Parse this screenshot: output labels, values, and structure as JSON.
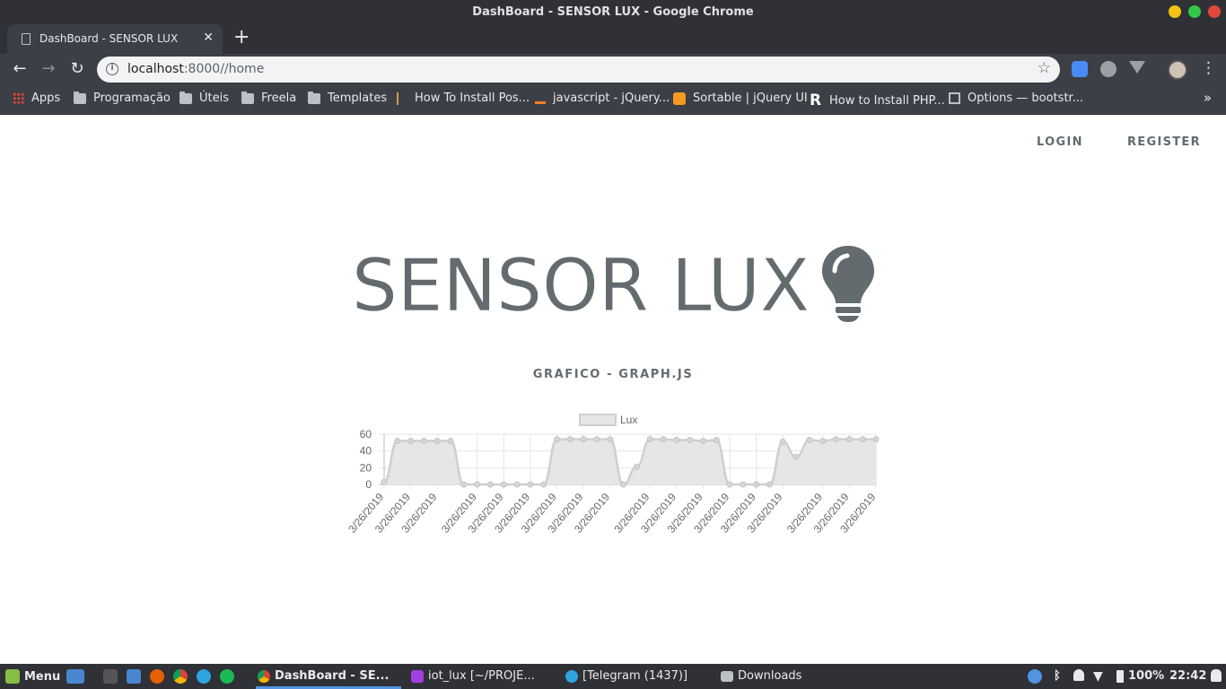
{
  "window": {
    "title": "DashBoard - SENSOR LUX - Google Chrome"
  },
  "tab": {
    "title": "DashBoard - SENSOR LUX",
    "close": "✕",
    "new_tab": "+"
  },
  "toolbar": {
    "back": "←",
    "forward": "→",
    "reload": "↻",
    "url_host": "localhost",
    "url_rest": ":8000//home",
    "info": "i",
    "star": "☆",
    "menu": "⋮"
  },
  "bookmarks": {
    "items": [
      {
        "label": "Apps",
        "icon": "apps-grid-icon"
      },
      {
        "label": "Programação",
        "icon": "folder-icon"
      },
      {
        "label": "Úteis",
        "icon": "folder-icon"
      },
      {
        "label": "Freela",
        "icon": "folder-icon"
      },
      {
        "label": "Templates",
        "icon": "folder-icon"
      },
      {
        "label": "How To Install Pos...",
        "icon": "favicon-icon"
      },
      {
        "label": "javascript - jQuery...",
        "icon": "stackoverflow-icon"
      },
      {
        "label": "Sortable | jQuery UI",
        "icon": "jquery-icon"
      },
      {
        "label": "How to Install PHP...",
        "icon": "r-icon"
      },
      {
        "label": "Options — bootstr...",
        "icon": "bootstrap-icon"
      }
    ],
    "more": "»"
  },
  "page": {
    "nav": {
      "login": "LOGIN",
      "register": "REGISTER"
    },
    "hero_title": "SENSOR LUX",
    "hero_icon": "lightbulb-icon",
    "subtitle": "GRAFICO - GRAPH.JS"
  },
  "chart_data": {
    "type": "line",
    "legend": [
      "Lux"
    ],
    "legend_position": "top",
    "grid": true,
    "fill": true,
    "ylim": [
      0,
      60
    ],
    "yticks": [
      0,
      20,
      40,
      60
    ],
    "x": [
      "3/26/2019",
      "3/26/2019",
      "3/26/2019",
      "3/26/2019",
      "3/26/2019",
      "3/26/2019",
      "3/26/2019",
      "3/26/2019",
      "3/26/2019",
      "3/26/2019",
      "3/26/2019",
      "3/26/2019",
      "3/26/2019",
      "3/26/2019",
      "3/26/2019",
      "3/26/2019",
      "3/26/2019",
      "3/26/2019",
      "3/26/2019",
      "3/26/2019",
      "3/26/2019",
      "3/26/2019",
      "3/26/2019",
      "3/26/2019",
      "3/26/2019",
      "3/26/2019",
      "3/26/2019",
      "3/26/2019",
      "3/26/2019",
      "3/26/2019",
      "3/26/2019",
      "3/26/2019",
      "3/26/2019",
      "3/26/2019",
      "3/26/2019",
      "3/26/2019",
      "3/26/2019",
      "3/26/2019"
    ],
    "xtick_labels": [
      "3/26/2019",
      "3/26/2019",
      "3/26/2019",
      "3/26/2019",
      "3/26/2019",
      "3/26/2019",
      "3/26/2019",
      "3/26/2019",
      "3/26/2019",
      "3/26/2019",
      "3/26/2019",
      "3/26/2019",
      "3/26/2019",
      "3/26/2019",
      "3/26/2019",
      "3/26/2019",
      "3/26/2019",
      "3/26/2019"
    ],
    "series": [
      {
        "name": "Lux",
        "values": [
          3,
          52,
          52,
          52,
          52,
          52,
          0,
          0,
          0,
          0,
          0,
          0,
          0,
          54,
          54,
          54,
          54,
          54,
          0,
          21,
          54,
          54,
          53,
          53,
          52,
          53,
          0,
          0,
          0,
          0,
          51,
          33,
          53,
          52,
          54,
          54,
          54,
          54
        ]
      }
    ]
  },
  "taskbar": {
    "menu": "Menu",
    "windows": [
      {
        "label": "DashBoard - SE...",
        "icon": "chrome-icon"
      },
      {
        "label": "iot_lux [~/PROJE...",
        "icon": "phpstorm-icon"
      },
      {
        "label": "[Telegram (1437)]",
        "icon": "telegram-icon"
      },
      {
        "label": "Downloads",
        "icon": "folder-icon"
      }
    ],
    "battery": "100%",
    "clock": "22:42"
  },
  "colors": {
    "chrome_dark": "#3c3f45",
    "text_gray": "#636b6f",
    "chart_fill": "#e6e6e6",
    "chart_line": "#cfcfcf"
  }
}
